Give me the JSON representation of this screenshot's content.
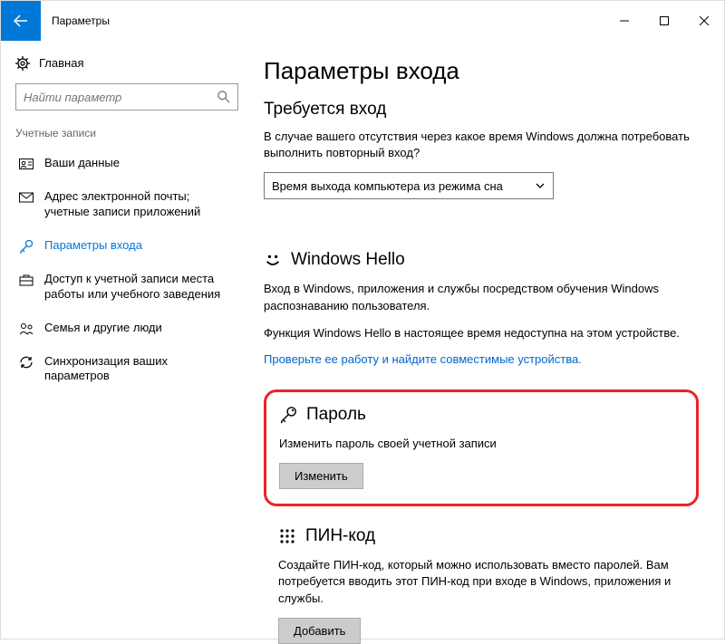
{
  "titlebar": {
    "title": "Параметры"
  },
  "sidebar": {
    "home": "Главная",
    "search_placeholder": "Найти параметр",
    "category": "Учетные записи",
    "items": [
      {
        "label": "Ваши данные"
      },
      {
        "label": "Адрес электронной почты; учетные записи приложений"
      },
      {
        "label": "Параметры входа"
      },
      {
        "label": "Доступ к учетной записи места работы или учебного заведения"
      },
      {
        "label": "Семья и другие люди"
      },
      {
        "label": "Синхронизация ваших параметров"
      }
    ]
  },
  "main": {
    "page_title": "Параметры входа",
    "signin_required": {
      "heading": "Требуется вход",
      "desc": "В случае вашего отсутствия через какое время Windows должна потребовать выполнить повторный вход?",
      "dropdown_value": "Время выхода компьютера из режима сна"
    },
    "hello": {
      "heading": "Windows Hello",
      "desc1": "Вход в Windows, приложения и службы посредством обучения Windows распознаванию пользователя.",
      "desc2": "Функция Windows Hello в настоящее время недоступна на этом устройстве.",
      "link": "Проверьте ее работу и найдите совместимые устройства."
    },
    "password": {
      "heading": "Пароль",
      "desc": "Изменить пароль своей учетной записи",
      "button": "Изменить"
    },
    "pin": {
      "heading": "ПИН-код",
      "desc": "Создайте ПИН-код, который можно использовать вместо паролей. Вам потребуется вводить этот ПИН-код при входе в Windows, приложения и службы.",
      "button": "Добавить"
    }
  }
}
